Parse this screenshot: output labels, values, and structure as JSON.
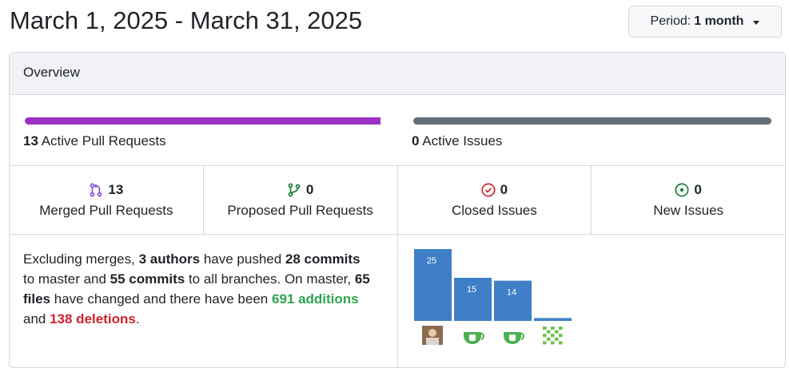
{
  "header": {
    "date_range": "March 1, 2025 - March 31, 2025",
    "period_prefix": "Period:",
    "period_value": "1 month"
  },
  "panel": {
    "title": "Overview"
  },
  "progress": {
    "prs_count": "13",
    "prs_label": "Active Pull Requests",
    "prs_color": "#9c31c3",
    "issues_count": "0",
    "issues_label": "Active Issues",
    "issues_color": "#656d76"
  },
  "stats": [
    {
      "count": "13",
      "label": "Merged Pull Requests",
      "icon": "git-merge-icon",
      "color": "#8250df"
    },
    {
      "count": "0",
      "label": "Proposed Pull Requests",
      "icon": "git-branch-icon",
      "color": "#1a7f37"
    },
    {
      "count": "0",
      "label": "Closed Issues",
      "icon": "issue-closed-icon",
      "color": "#cf222e"
    },
    {
      "count": "0",
      "label": "New Issues",
      "icon": "issue-opened-icon",
      "color": "#1a7f37"
    }
  ],
  "summary": {
    "t1": "Excluding merges, ",
    "authors": "3 authors",
    "t2": " have pushed ",
    "commits_master": "28 commits",
    "t3": " to master and ",
    "commits_all": "55 commits",
    "t4": " to all branches. On master, ",
    "files": "65 files",
    "t5": " have changed and there have been ",
    "additions": "691 additions",
    "t6": " and ",
    "deletions": "138 deletions",
    "t7": "."
  },
  "chart_data": {
    "type": "bar",
    "values": [
      25,
      15,
      14,
      1
    ],
    "data_labels": [
      "25",
      "15",
      "14",
      ""
    ],
    "avatars": [
      "photo-avatar",
      "teapot-avatar",
      "teapot-avatar",
      "identicon-avatar"
    ],
    "bar_color": "#3f7fc7",
    "ylim": [
      0,
      25
    ]
  }
}
